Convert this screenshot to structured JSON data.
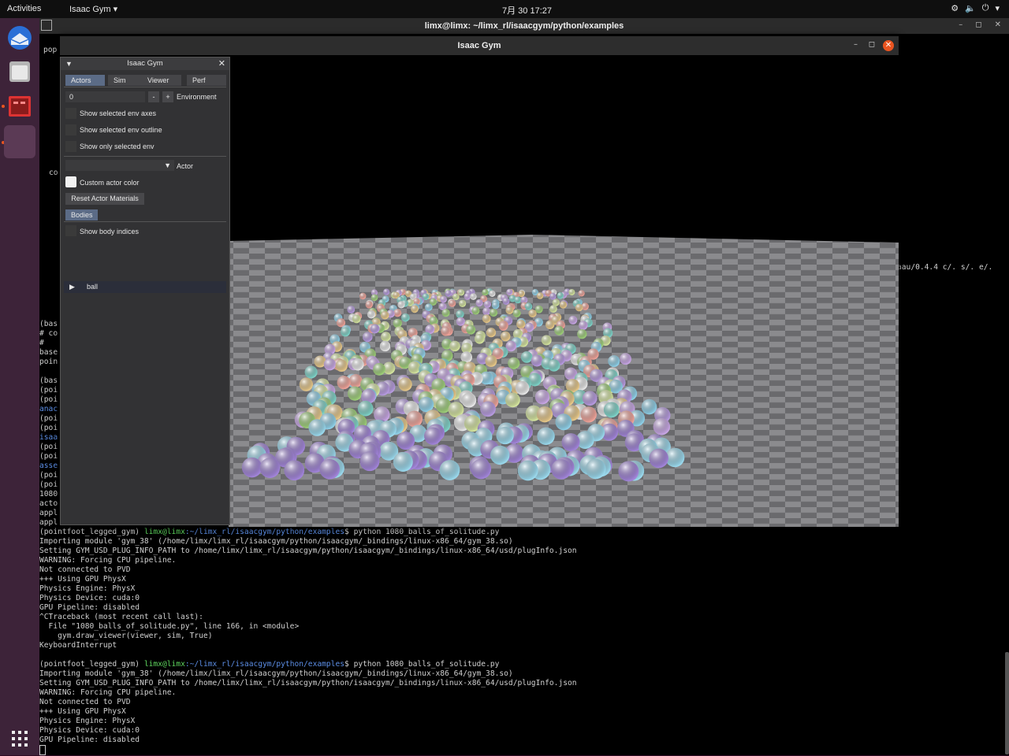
{
  "topbar": {
    "activities": "Activities",
    "app_menu": "Isaac Gym ▾",
    "clock": "7月 30  17:27",
    "tray_icons": [
      "network-icon",
      "volume-icon",
      "power-icon",
      "chevron-down-icon"
    ]
  },
  "dock": {
    "items": [
      "thunderbird-icon",
      "files-icon",
      "terminal-app-icon",
      "isaac-gym-app-icon"
    ],
    "apps_grid": "show-apps-icon"
  },
  "terminal": {
    "title": "limx@limx: ~/limx_rl/isaacgym/python/examples",
    "partial_lines": {
      "pop": "pop",
      "co": "co",
      "right_fragment": "aau/0.4.4 c/. s/. e/."
    },
    "left_fragments": [
      "(bas",
      "# co",
      "#",
      "base",
      "poin",
      "",
      "(bas",
      "(poi",
      "(poi",
      "anac",
      "(poi",
      "(poi",
      "isaa",
      "(poi",
      "(poi",
      "asse",
      "(poi",
      "(poi",
      "1080",
      "acto",
      "appl",
      "appl"
    ],
    "prompt_env": "(pointfoot_legged_gym) ",
    "prompt_user": "limx@limx",
    "prompt_path": ":~/limx_rl/isaacgym/python/examples",
    "command": "$ python 1080_balls_of_solitude.py",
    "output_1": [
      "Importing module 'gym_38' (/home/limx/limx_rl/isaacgym/python/isaacgym/_bindings/linux-x86_64/gym_38.so)",
      "Setting GYM_USD_PLUG_INFO_PATH to /home/limx/limx_rl/isaacgym/python/isaacgym/_bindings/linux-x86_64/usd/plugInfo.json",
      "WARNING: Forcing CPU pipeline.",
      "Not connected to PVD",
      "+++ Using GPU PhysX",
      "Physics Engine: PhysX",
      "Physics Device: cuda:0",
      "GPU Pipeline: disabled",
      "^CTraceback (most recent call last):",
      "  File \"1080_balls_of_solitude.py\", line 166, in <module>",
      "    gym.draw_viewer(viewer, sim, True)",
      "KeyboardInterrupt",
      ""
    ],
    "output_2": [
      "Importing module 'gym_38' (/home/limx/limx_rl/isaacgym/python/isaacgym/_bindings/linux-x86_64/gym_38.so)",
      "Setting GYM_USD_PLUG_INFO_PATH to /home/limx/limx_rl/isaacgym/python/isaacgym/_bindings/linux-x86_64/usd/plugInfo.json",
      "WARNING: Forcing CPU pipeline.",
      "Not connected to PVD",
      "+++ Using GPU PhysX",
      "Physics Engine: PhysX",
      "Physics Device: cuda:0",
      "GPU Pipeline: disabled"
    ]
  },
  "gym_window": {
    "title": "Isaac Gym",
    "panel": {
      "title": "Isaac Gym",
      "tabs": [
        "Actors",
        "Sim",
        "Viewer",
        "Perf"
      ],
      "env_value": "0",
      "minus": "-",
      "plus": "+",
      "env_label": "Environment",
      "show_axes": "Show selected env axes",
      "show_outline": "Show selected env outline",
      "show_only": "Show only selected env",
      "actor_label": "Actor",
      "custom_color": "Custom actor color",
      "reset_materials": "Reset Actor Materials",
      "bodies_header": "Bodies",
      "show_body_indices": "Show body indices",
      "body_item": "ball"
    }
  },
  "colors": {
    "ubuntu_orange": "#e95420",
    "prompt_green": "#5fd75f",
    "prompt_blue": "#5c8ee6",
    "active_tab": "#5b6b86"
  }
}
